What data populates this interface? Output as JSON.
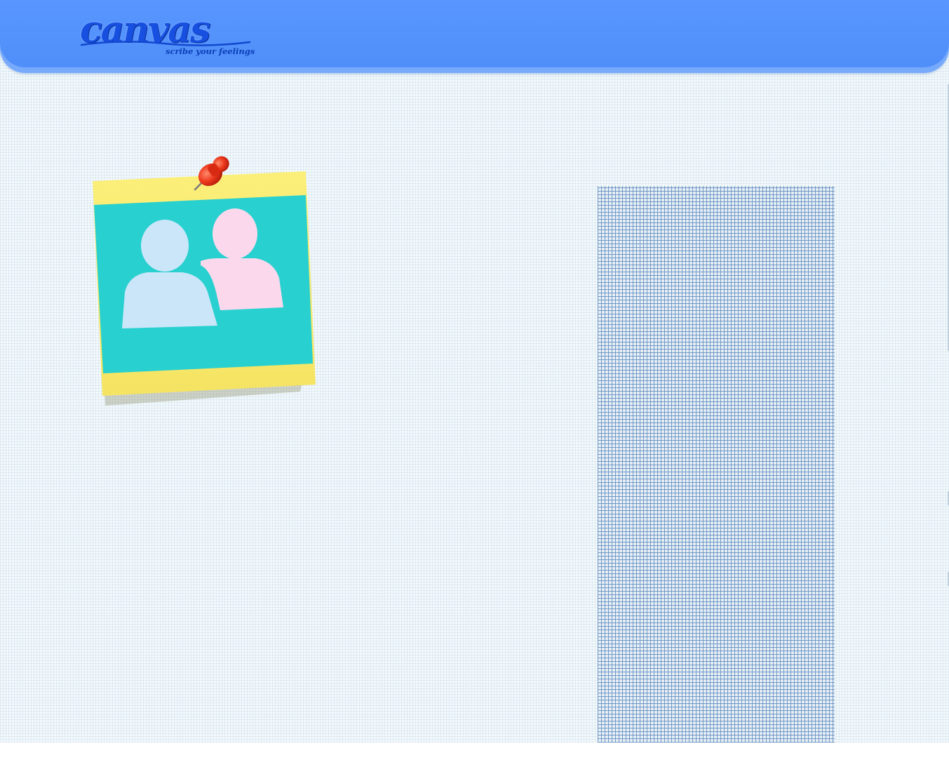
{
  "header": {
    "logo": {
      "wordmark": "canvas",
      "tagline": "scribe your feelings"
    },
    "colors": {
      "bar": "#5996ff",
      "logo": "#1750e0"
    }
  },
  "board": {
    "sticky_note": {
      "icon": "people-icon",
      "pin_icon": "pushpin-icon",
      "colors": {
        "note": "#f9ea6e",
        "card": "#29d0d0",
        "person_blue": "#cbe6f8",
        "person_pink": "#fbd8ec",
        "pin": "#e8301a"
      }
    },
    "side_panel": {
      "pattern": "grid"
    }
  }
}
